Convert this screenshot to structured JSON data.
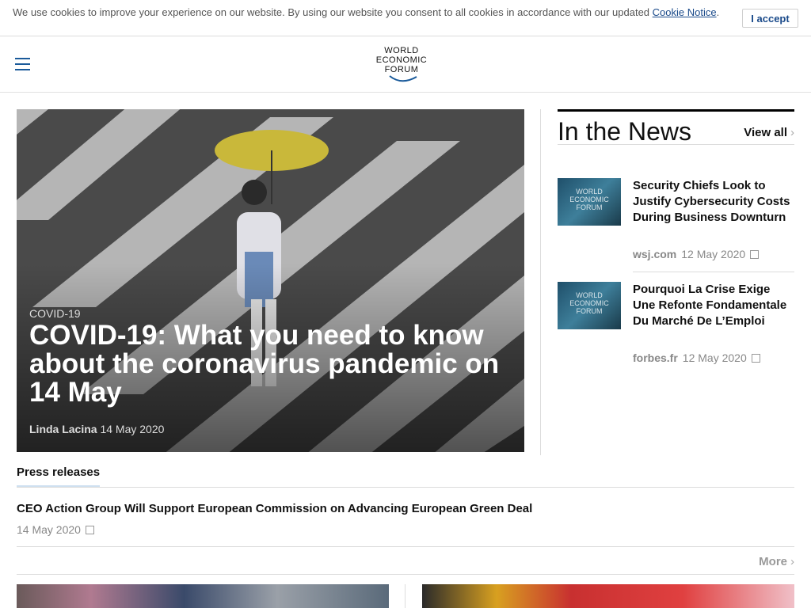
{
  "cookie": {
    "text": "We use cookies to improve your experience on our website. By using our website you consent to all cookies in accordance with our updated ",
    "link": "Cookie Notice",
    "end": ".",
    "accept": "I accept"
  },
  "header": {
    "logo_line1": "WORLD",
    "logo_line2": "ECONOMIC",
    "logo_line3": "FORUM"
  },
  "hero": {
    "tag": "COVID-19",
    "title": "COVID-19: What you need to know about the coronavirus pandemic on 14 May",
    "author": "Linda Lacina",
    "date": "14 May 2020"
  },
  "news": {
    "heading": "In the News",
    "view_all": "View all",
    "items": [
      {
        "title": "Security Chiefs Look to Justify Cybersecurity Costs During Business Downturn",
        "source": "wsj.com",
        "date": "12 May 2020",
        "thumb_line1": "WORLD",
        "thumb_line2": "ECONOMIC",
        "thumb_line3": "FORUM"
      },
      {
        "title": "Pourquoi La Crise Exige Une Refonte Fondamentale Du Marché De L’Emploi",
        "source": "forbes.fr",
        "date": "12 May 2020",
        "thumb_line1": "WORLD",
        "thumb_line2": "ECONOMIC",
        "thumb_line3": "FORUM"
      }
    ]
  },
  "press": {
    "heading": "Press releases",
    "item_title": "CEO Action Group Will Support European Commission on Advancing European Green Deal",
    "item_date": "14 May 2020",
    "more": "More"
  }
}
